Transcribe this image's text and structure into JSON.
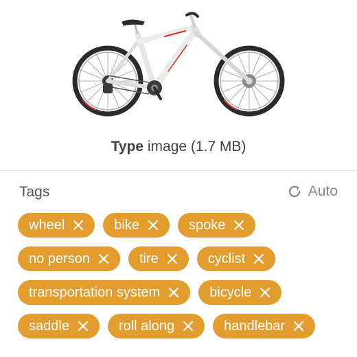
{
  "preview": {
    "image_subject": "white mountain bicycle with red accents",
    "colors": {
      "frame": "#ececec",
      "accent": "#d9302a",
      "tire": "#2b2b2b",
      "component": "#3a3a3a"
    }
  },
  "meta": {
    "type_label": "Type",
    "type_value": "image (1.7 MB)"
  },
  "tags": {
    "title": "Tags",
    "auto_label": "Auto",
    "auto_icon": "refresh-icon",
    "chip_color": "#e39c2e",
    "rows": [
      [
        "wheel",
        "bike",
        "spoke"
      ],
      [
        "no person",
        "tire",
        "cyclist"
      ],
      [
        "transportation system",
        "bicycle"
      ],
      [
        "saddle",
        "roll along",
        "handlebar"
      ]
    ]
  }
}
